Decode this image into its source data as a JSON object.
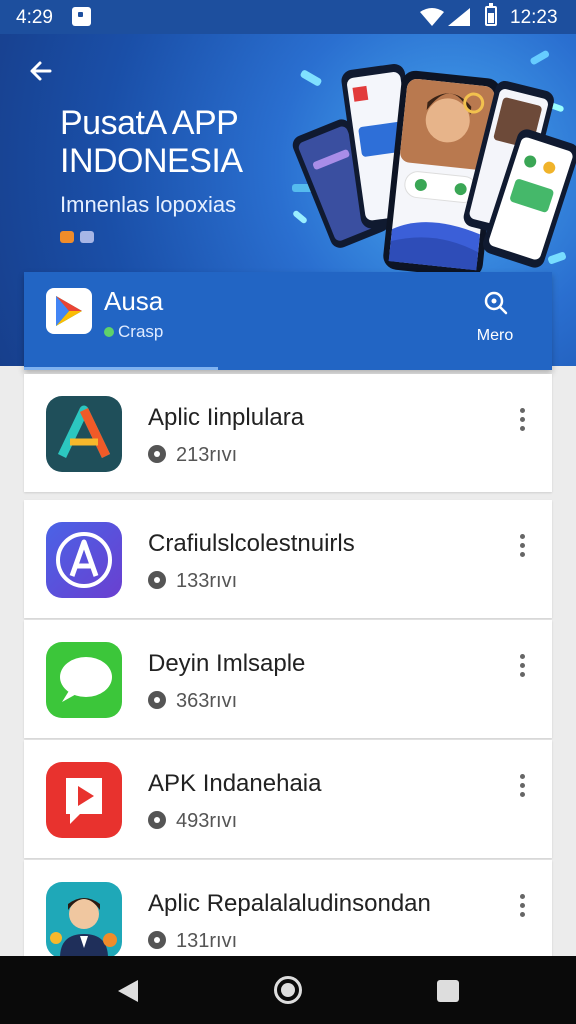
{
  "status_bar": {
    "time_left": "4:29",
    "time_right": "12:23"
  },
  "hero": {
    "title_line1": "PusatA APP",
    "title_line2": "INDONESIA",
    "subtitle": "Imnenlas lopoxias"
  },
  "app_card": {
    "title": "Ausa",
    "subtitle": "Crasp",
    "menu_label": "Mero"
  },
  "apps": [
    {
      "name": "Aplic Iinplulara",
      "meta": "213rıvı",
      "icon": "letter-a-icon"
    },
    {
      "name": "Crafiulslcolestnuirls",
      "meta": "133rıvı",
      "icon": "app-store-icon"
    },
    {
      "name": "Deyin Imlsaple",
      "meta": "363rıvı",
      "icon": "chat-bubble-icon"
    },
    {
      "name": "APK Indanehaia",
      "meta": "493rıvı",
      "icon": "play-button-icon"
    },
    {
      "name": "Aplic Repalalaludinsondan",
      "meta": "131rıvı",
      "icon": "avatar-icon"
    }
  ],
  "colors": {
    "primary": "#2265c4",
    "status_bar": "#1d4f9e",
    "background": "#ececec"
  }
}
